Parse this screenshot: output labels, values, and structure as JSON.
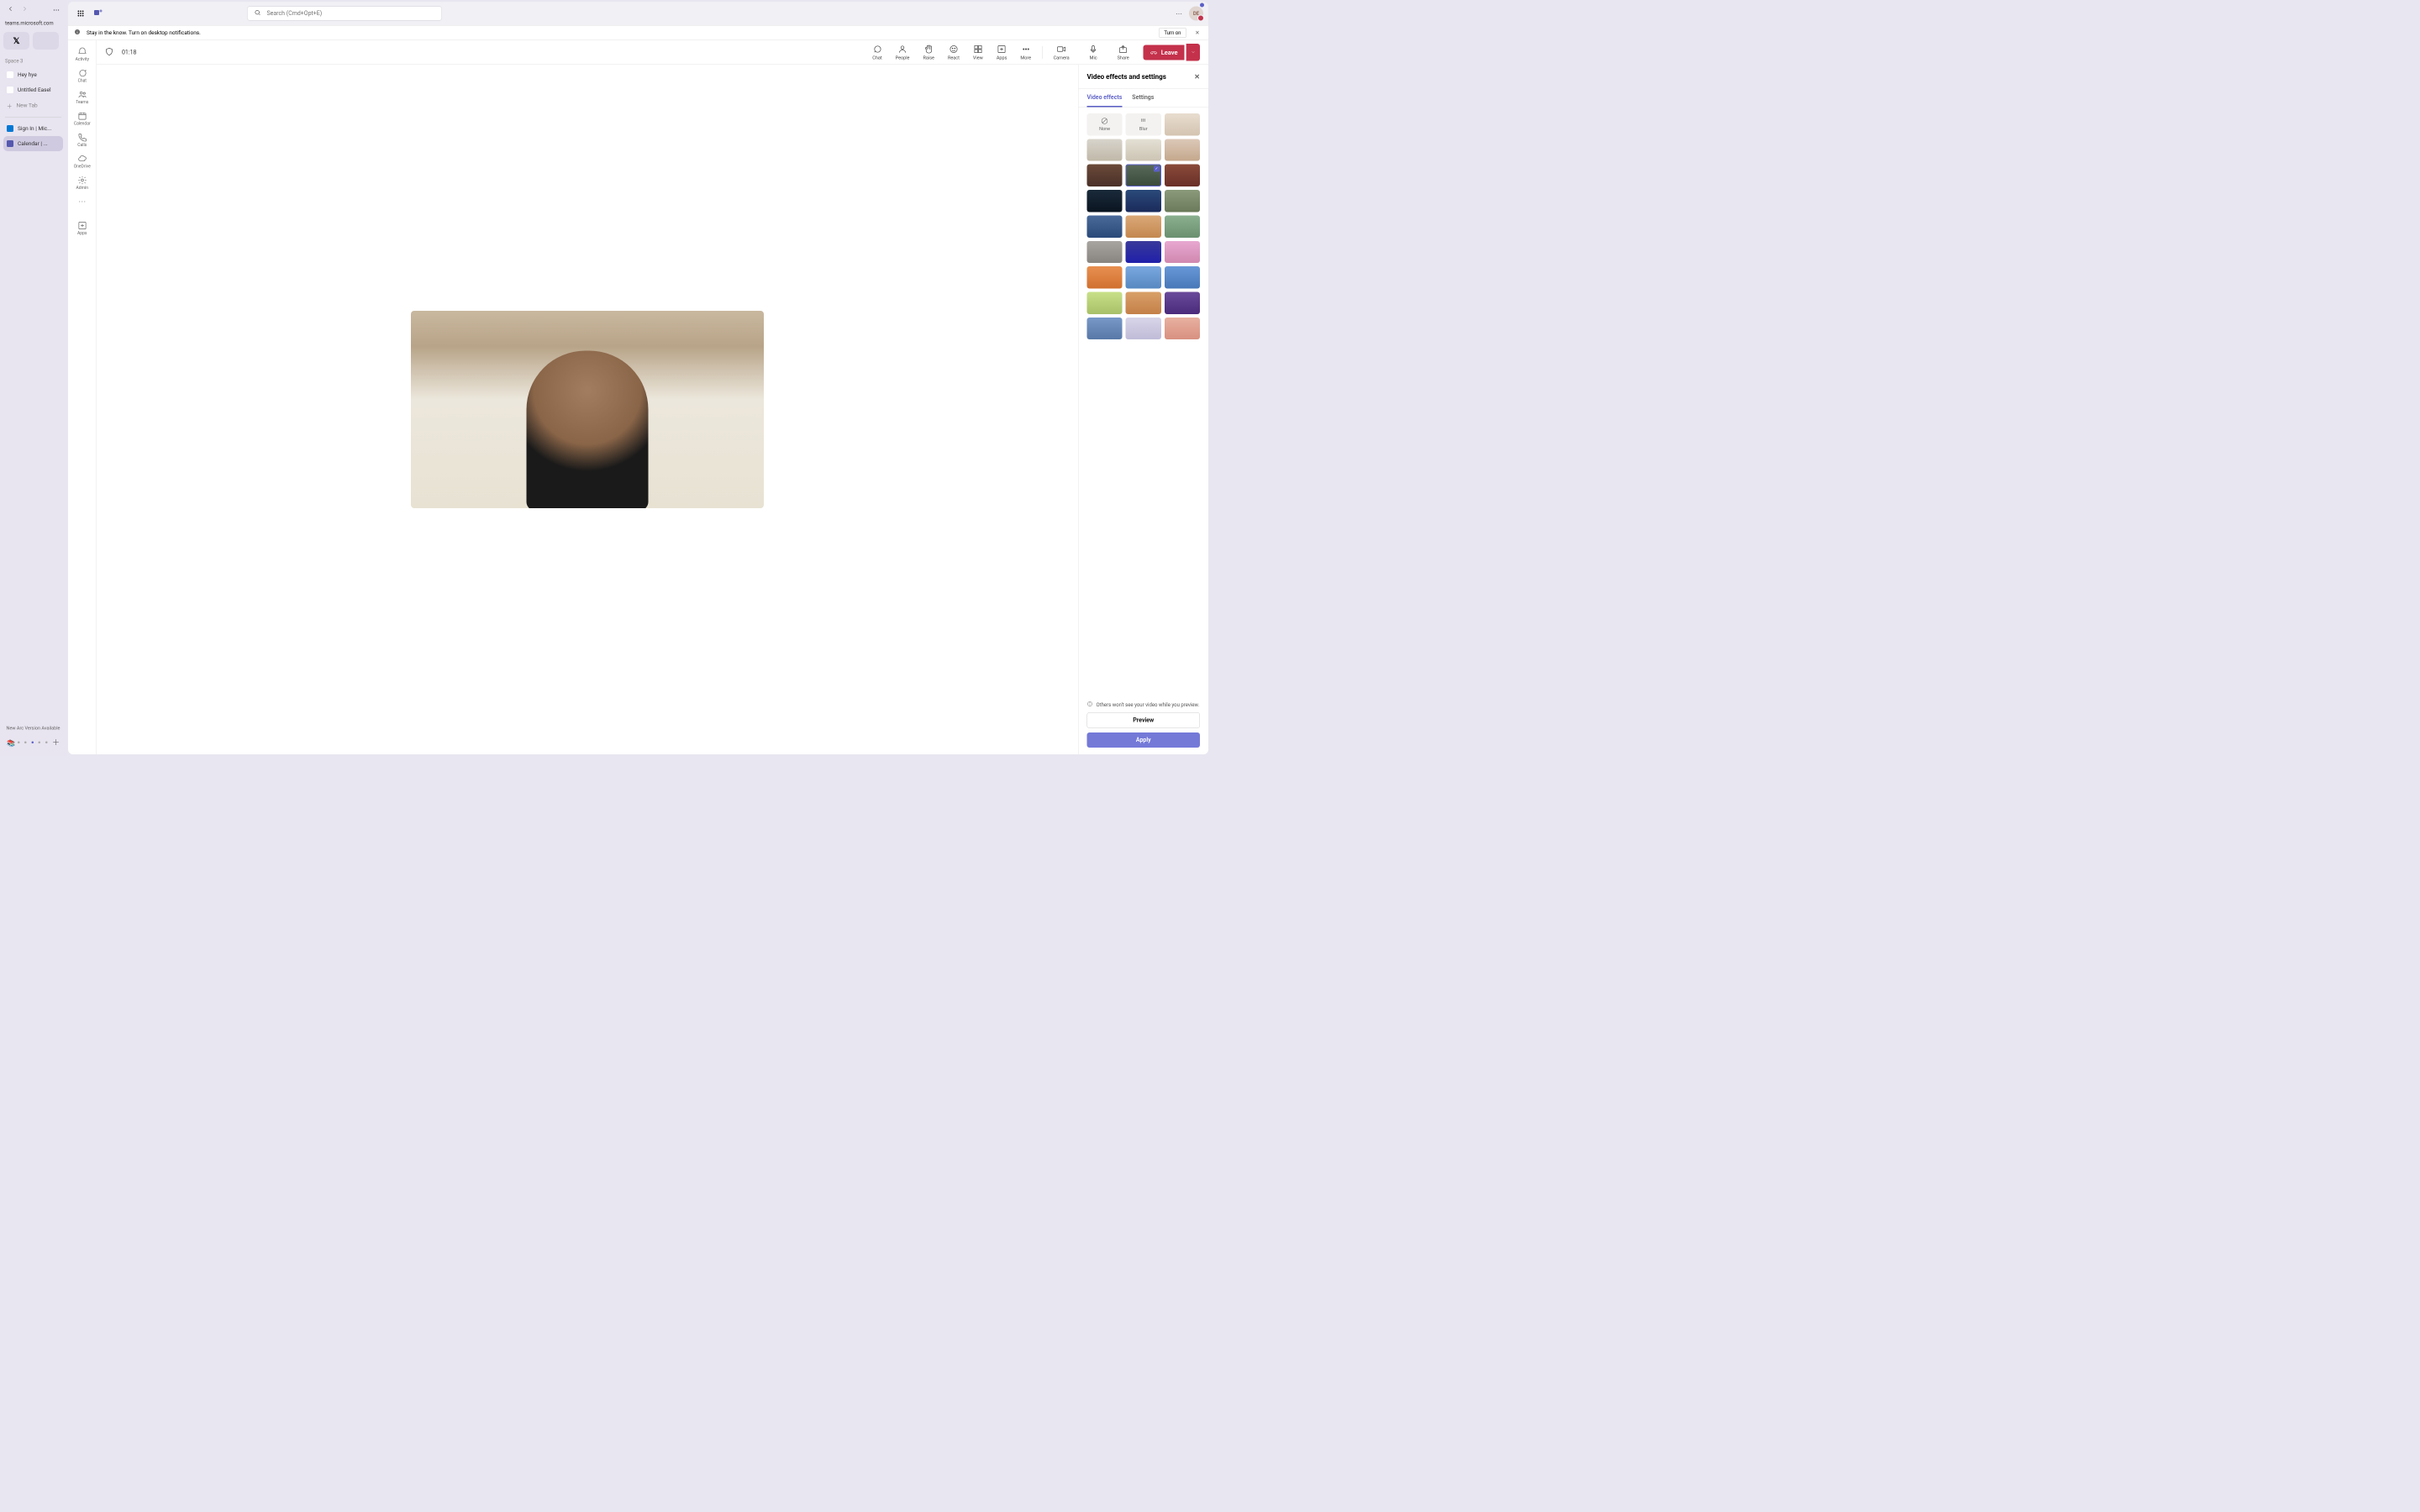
{
  "arc": {
    "url": "teams.microsoft.com",
    "space": "Space 3",
    "tabs": [
      {
        "label": "Hey hye"
      },
      {
        "label": "Untitled Easel"
      }
    ],
    "newtab": "New Tab",
    "tabs2": [
      {
        "label": "Sign In | Mic..."
      },
      {
        "label": "Calendar | ..."
      }
    ],
    "version": "New Arc Version Available"
  },
  "search": {
    "placeholder": "Search (Cmd+Opt+E)"
  },
  "avatar": "DE",
  "notif": {
    "text": "Stay in the know. Turn on desktop notifications.",
    "btn": "Turn on"
  },
  "rail": [
    {
      "label": "Activity"
    },
    {
      "label": "Chat"
    },
    {
      "label": "Teams"
    },
    {
      "label": "Calendar"
    },
    {
      "label": "Calls"
    },
    {
      "label": "OneDrive"
    },
    {
      "label": "Admin"
    }
  ],
  "rail_apps": "Apps",
  "timer": "01:18",
  "toolbar": {
    "chat": "Chat",
    "people": "People",
    "raise": "Raise",
    "react": "React",
    "view": "View",
    "apps": "Apps",
    "more": "More",
    "camera": "Camera",
    "mic": "Mic",
    "share": "Share",
    "leave": "Leave"
  },
  "panel": {
    "title": "Video effects and settings",
    "tabs": {
      "effects": "Video effects",
      "settings": "Settings"
    },
    "none": "None",
    "blur": "Blur",
    "note": "Others won't see your video while you preview.",
    "preview": "Preview",
    "apply": "Apply"
  }
}
